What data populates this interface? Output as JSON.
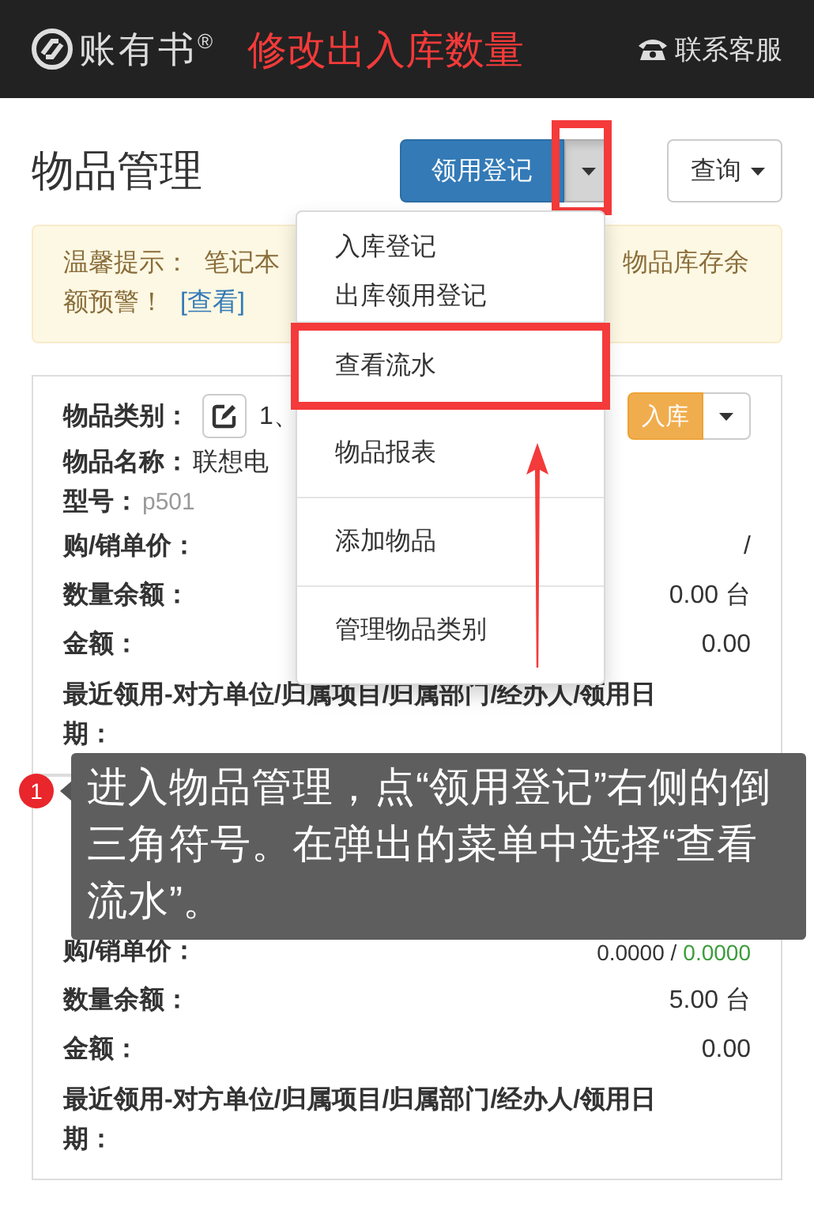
{
  "header": {
    "logo": "账有书$^{®}$",
    "annotation_title": "修改出入库数量",
    "service_link": "联系客服"
  },
  "toolbar": {
    "title": "物品管理",
    "primary_button": {
      "label": "领用登记",
      "menu_expanded": true
    },
    "query_button": {
      "label": "查询"
    }
  },
  "alert": {
    "left_text": "温馨提示：  笔记本",
    "right_text": "物品库存余",
    "line2": "额预警！",
    "link": "[查看]"
  },
  "dropdown_menu": {
    "items": [
      {
        "label": "入库登记",
        "divider_before": false,
        "annotated": false
      },
      {
        "label": "出库领用登记",
        "divider_before": false,
        "annotated": false
      },
      {
        "label": "查看流水",
        "divider_before": true,
        "annotated": true
      },
      {
        "label": "物品报表",
        "divider_before": false,
        "annotated": false
      },
      {
        "label": "添加物品",
        "divider_before": true,
        "annotated": false
      },
      {
        "label": "管理物品类别",
        "divider_before": true,
        "annotated": false
      }
    ]
  },
  "cards": [
    {
      "category_label": "物品类别：",
      "category": "1、",
      "action": {
        "label": "入库",
        "kind": "warning"
      },
      "fields": [
        {
          "label": "物品名称：",
          "value": "联想电",
          "kind": "inline"
        },
        {
          "label": "型号：",
          "value": "p501",
          "kind": "muted"
        },
        {
          "label": "购/销单价：",
          "value": "/",
          "kind": "right"
        },
        {
          "label": "数量余额：",
          "value": "0.00 台",
          "kind": "right"
        },
        {
          "label": "金额：",
          "value": "0.00",
          "kind": "right"
        },
        {
          "label": "最近领用-对方单位/归属项目/归属部门/经办人/领用日期：",
          "kind": "heading"
        }
      ]
    },
    {
      "fields": [
        {
          "label": "购/销单价：",
          "value": "0.0000 /",
          "sell_value": "0.0000",
          "kind": "right"
        },
        {
          "label": "数量余额：",
          "value": "5.00 台",
          "kind": "right"
        },
        {
          "label": "金额：",
          "value": "0.00",
          "kind": "right"
        },
        {
          "label": "最近领用-对方单位/归属项目/归属部门/经办人/领用日期：",
          "kind": "heading"
        }
      ]
    }
  ],
  "guide_tip": {
    "step": "1",
    "text": "进入物品管理，点“领用登记”右侧的倒三角符号。在弹出的菜单中选择“查看流水”。"
  }
}
